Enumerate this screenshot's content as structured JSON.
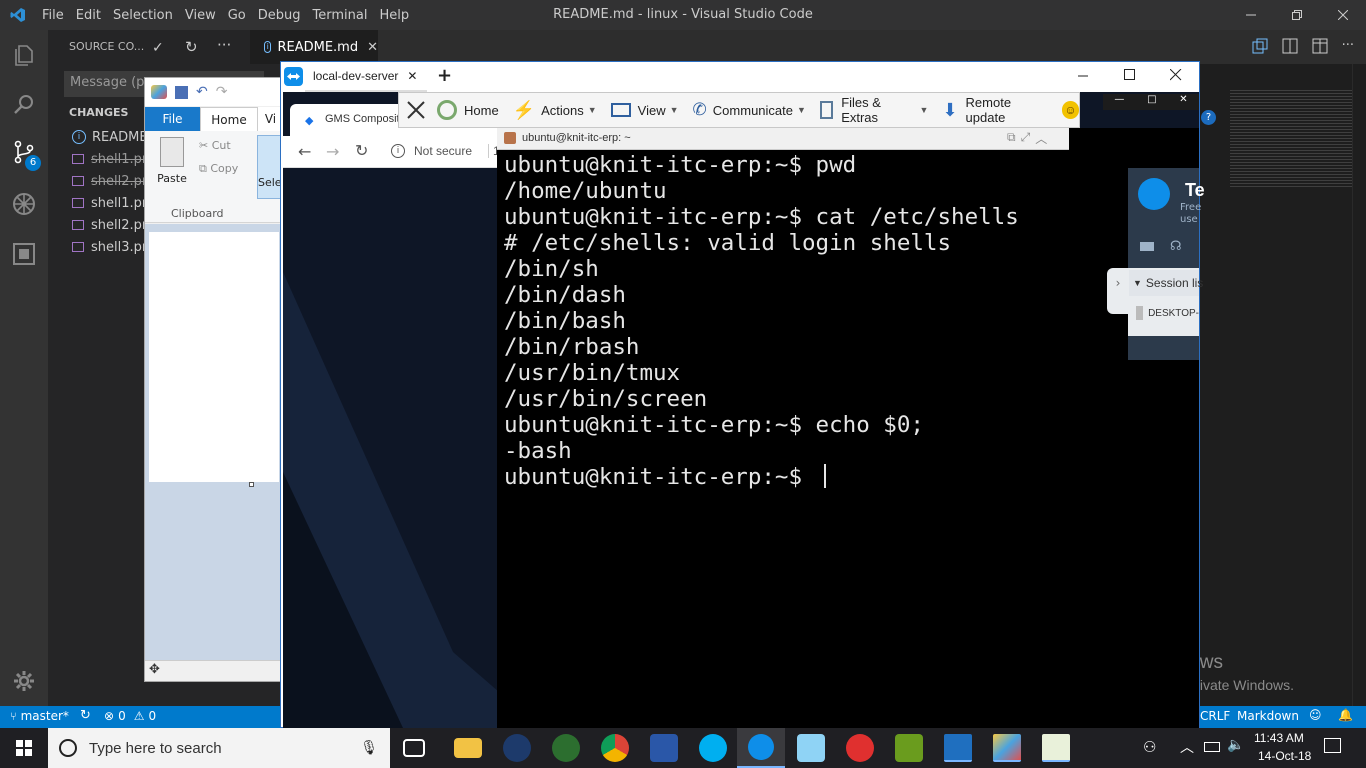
{
  "vscode": {
    "menu": [
      "File",
      "Edit",
      "Selection",
      "View",
      "Go",
      "Debug",
      "Terminal",
      "Help"
    ],
    "window_title": "README.md - linux - Visual Studio Code",
    "activity_badge": "6",
    "sidebar": {
      "header": "SOURCE CO...",
      "message_placeholder": "Message (pr",
      "changes_label": "CHANGES",
      "files": [
        "README.",
        "shell1.png",
        "shell2.png",
        "shell1.png",
        "shell2.png",
        "shell3.png"
      ]
    },
    "tab": {
      "label": "README.md"
    },
    "status": {
      "branch": "master*",
      "errors": "0",
      "warnings": "0",
      "eol": "CRLF",
      "language": "Markdown"
    },
    "accent": "#007acc"
  },
  "paint": {
    "tabs": [
      "File",
      "Home",
      "Vi"
    ],
    "paste": "Paste",
    "cut": "Cut",
    "copy": "Copy",
    "select": "Sele",
    "group": "Clipboard"
  },
  "teamviewer": {
    "tab_label": "local-dev-server",
    "toolbar": {
      "home": "Home",
      "actions": "Actions",
      "view": "View",
      "communicate": "Communicate",
      "files": "Files & Extras",
      "remote_update": "Remote update"
    },
    "panel": {
      "title": "Te",
      "sub1": "Free",
      "sub2": "use",
      "session_list": "Session lis",
      "device": "DESKTOP-"
    }
  },
  "remote": {
    "chrome": {
      "tab_label": "GMS Composit",
      "not_secure": "Not secure",
      "addr_rest": "1"
    },
    "terminal": {
      "title": "ubuntu@knit-itc-erp: ~",
      "lines": [
        "ubuntu@knit-itc-erp:~$ pwd",
        "/home/ubuntu",
        "ubuntu@knit-itc-erp:~$ cat /etc/shells",
        "# /etc/shells: valid login shells",
        "/bin/sh",
        "/bin/dash",
        "/bin/bash",
        "/bin/rbash",
        "/usr/bin/tmux",
        "/usr/bin/screen",
        "ubuntu@knit-itc-erp:~$ echo $0;",
        "-bash",
        "ubuntu@knit-itc-erp:~$ "
      ]
    }
  },
  "watermark": {
    "line1": "Activate Windows",
    "line2": "Go to Settings to activate Windows."
  },
  "taskbar": {
    "search_placeholder": "Type here to search",
    "time": "11:43 AM",
    "date": "14-Oct-18"
  }
}
